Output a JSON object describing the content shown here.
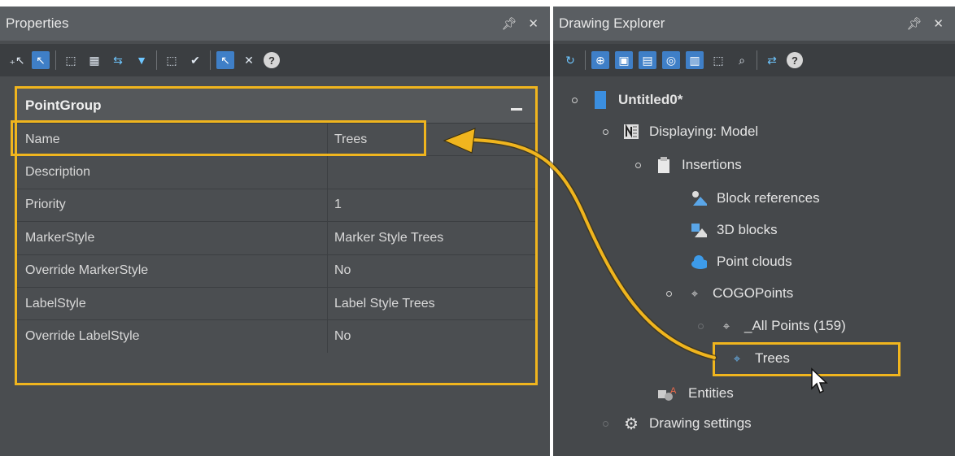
{
  "properties_panel": {
    "title": "Properties",
    "pin_icon": "pin-icon",
    "close_icon": "close-icon",
    "group": {
      "name": "PointGroup"
    },
    "rows": [
      {
        "key": "Name",
        "value": "Trees"
      },
      {
        "key": "Description",
        "value": ""
      },
      {
        "key": "Priority",
        "value": "1"
      },
      {
        "key": "MarkerStyle",
        "value": "Marker Style Trees"
      },
      {
        "key": "Override MarkerStyle",
        "value": "No"
      },
      {
        "key": "LabelStyle",
        "value": "Label Style Trees"
      },
      {
        "key": "Override LabelStyle",
        "value": "No"
      }
    ]
  },
  "explorer_panel": {
    "title": "Drawing Explorer",
    "tree": [
      {
        "label": "Untitled0*",
        "icon": "document-icon"
      },
      {
        "label": "Displaying: Model",
        "icon": "model-icon"
      },
      {
        "label": "Insertions",
        "icon": "clipboard-icon"
      },
      {
        "label": "Block references",
        "icon": "block-reference-icon"
      },
      {
        "label": "3D blocks",
        "icon": "3d-block-icon"
      },
      {
        "label": "Point clouds",
        "icon": "cloud-icon"
      },
      {
        "label": "COGOPoints",
        "icon": "cogo-point-icon"
      },
      {
        "label": "_All Points (159)",
        "icon": "cogo-point-icon"
      },
      {
        "label": "Trees",
        "icon": "cogo-point-icon"
      },
      {
        "label": "Entities",
        "icon": "entities-icon"
      },
      {
        "label": "Drawing settings",
        "icon": "gear-icon"
      }
    ]
  },
  "colors": {
    "highlight": "#f0b51e",
    "accent": "#3f7fc7"
  }
}
